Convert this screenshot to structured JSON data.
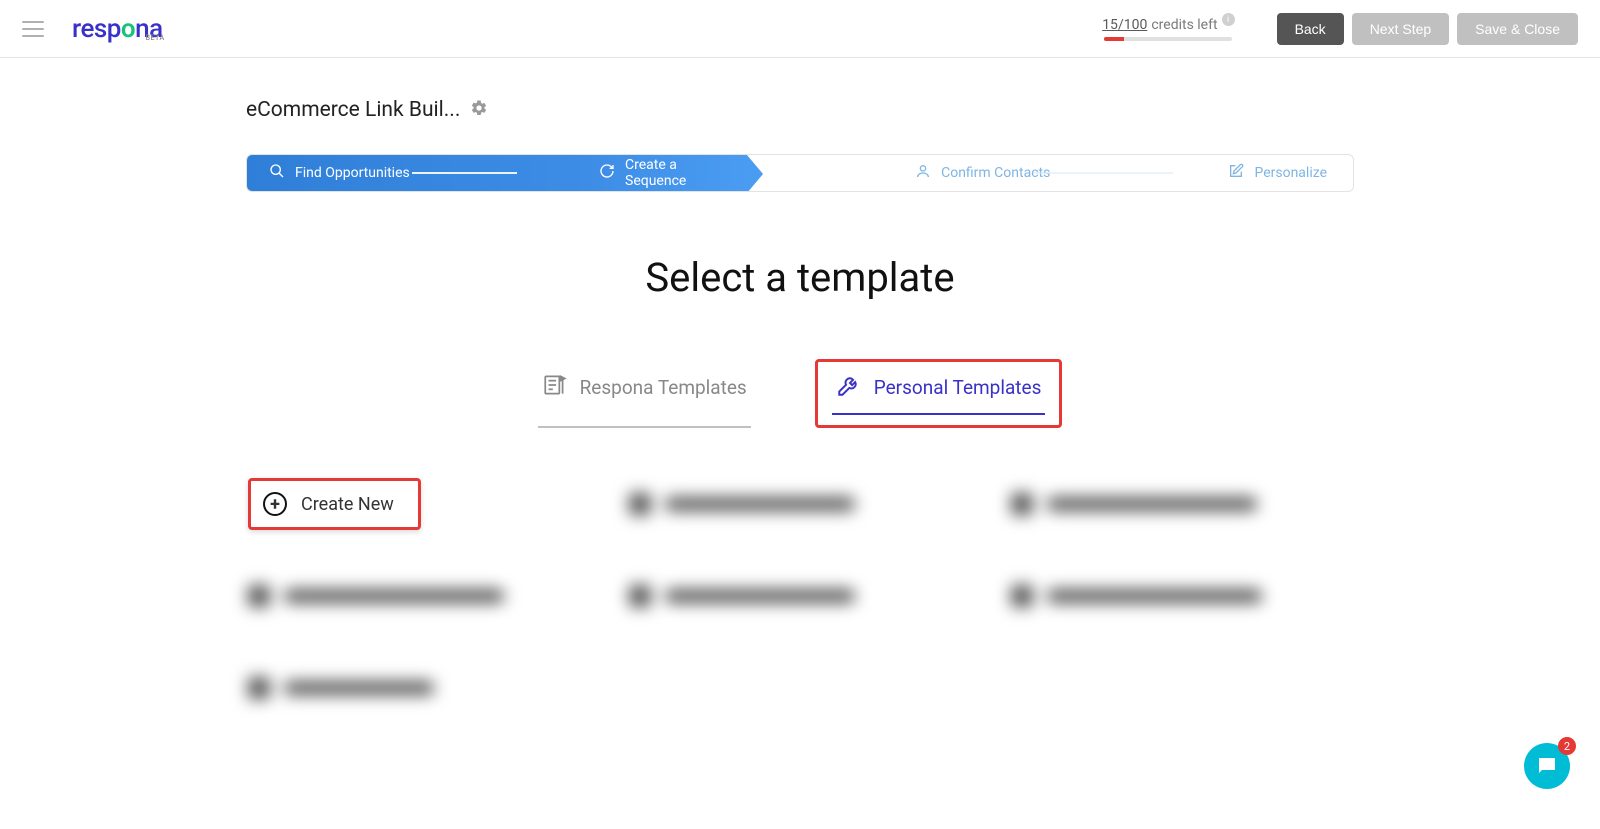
{
  "header": {
    "logo": "respona",
    "logo_beta": "BETA",
    "credits_used": "15",
    "credits_total": "100",
    "credits_label": "credits left",
    "back_label": "Back",
    "next_label": "Next Step",
    "save_label": "Save & Close"
  },
  "campaign": {
    "title": "eCommerce Link Buil..."
  },
  "stepper": {
    "step1": "Find Opportunities",
    "step2": "Create a Sequence",
    "step3": "Confirm Contacts",
    "step4": "Personalize"
  },
  "main": {
    "heading": "Select a template",
    "tabs": {
      "respona": "Respona Templates",
      "personal": "Personal Templates"
    },
    "create_new": "Create New"
  },
  "chat": {
    "badge": "2"
  }
}
